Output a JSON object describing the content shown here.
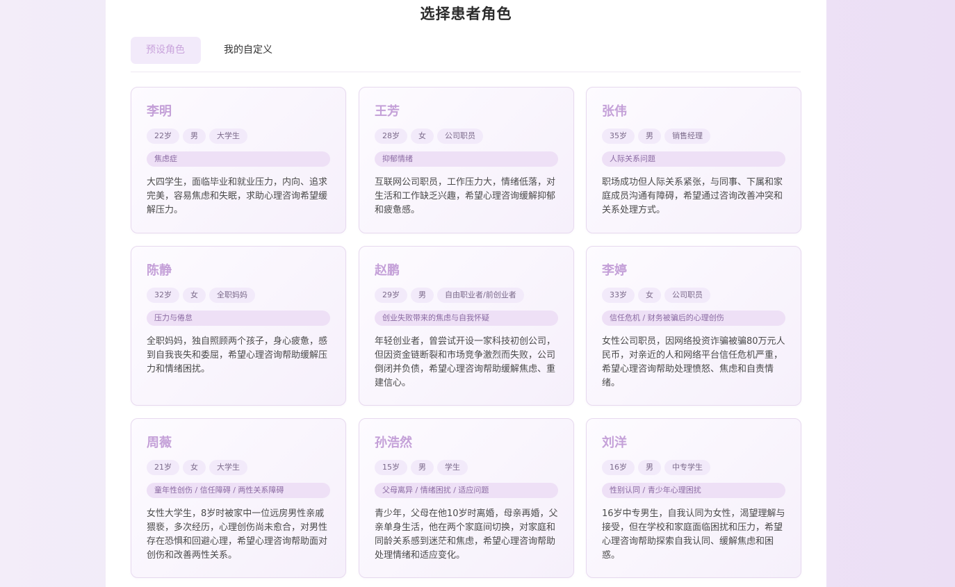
{
  "page": {
    "title": "选择患者角色"
  },
  "tabs": [
    {
      "label": "预设角色",
      "active": true
    },
    {
      "label": "我的自定义",
      "active": false
    }
  ],
  "colors": {
    "accent": "#c4a0d8",
    "tag_bg": "#f2eafa",
    "issue_bg": "#eee0f6"
  },
  "cards": [
    {
      "name": "李明",
      "tags": [
        "22岁",
        "男",
        "大学生"
      ],
      "issue": "焦虑症",
      "desc": "大四学生，面临毕业和就业压力，内向、追求完美，容易焦虑和失眠，求助心理咨询希望缓解压力。"
    },
    {
      "name": "王芳",
      "tags": [
        "28岁",
        "女",
        "公司职员"
      ],
      "issue": "抑郁情绪",
      "desc": "互联网公司职员，工作压力大，情绪低落，对生活和工作缺乏兴趣，希望心理咨询缓解抑郁和疲惫感。"
    },
    {
      "name": "张伟",
      "tags": [
        "35岁",
        "男",
        "销售经理"
      ],
      "issue": "人际关系问题",
      "desc": "职场成功但人际关系紧张，与同事、下属和家庭成员沟通有障碍，希望通过咨询改善冲突和关系处理方式。"
    },
    {
      "name": "陈静",
      "tags": [
        "32岁",
        "女",
        "全职妈妈"
      ],
      "issue": "压力与倦怠",
      "desc": "全职妈妈，独自照顾两个孩子，身心疲惫，感到自我丧失和委屈，希望心理咨询帮助缓解压力和情绪困扰。"
    },
    {
      "name": "赵鹏",
      "tags": [
        "29岁",
        "男",
        "自由职业者/前创业者"
      ],
      "issue": "创业失败带来的焦虑与自我怀疑",
      "desc": "年轻创业者，曾尝试开设一家科技初创公司，但因资金链断裂和市场竞争激烈而失败，公司倒闭并负债，希望心理咨询帮助缓解焦虑、重建信心。"
    },
    {
      "name": "李婷",
      "tags": [
        "33岁",
        "女",
        "公司职员"
      ],
      "issue": "信任危机 / 财务被骗后的心理创伤",
      "desc": "女性公司职员，因网络投资诈骗被骗80万元人民币，对亲近的人和网络平台信任危机严重，希望心理咨询帮助处理愤怒、焦虑和自责情绪。"
    },
    {
      "name": "周薇",
      "tags": [
        "21岁",
        "女",
        "大学生"
      ],
      "issue": "童年性创伤 / 信任障碍 / 两性关系障碍",
      "desc": "女性大学生，8岁时被家中一位远房男性亲戚猥亵，多次经历，心理创伤尚未愈合，对男性存在恐惧和回避心理，希望心理咨询帮助面对创伤和改善两性关系。"
    },
    {
      "name": "孙浩然",
      "tags": [
        "15岁",
        "男",
        "学生"
      ],
      "issue": "父母离异 / 情绪困扰 / 适应问题",
      "desc": "青少年，父母在他10岁时离婚，母亲再婚，父亲单身生活，他在两个家庭间切换，对家庭和同龄关系感到迷茫和焦虑，希望心理咨询帮助处理情绪和适应变化。"
    },
    {
      "name": "刘洋",
      "tags": [
        "16岁",
        "男",
        "中专学生"
      ],
      "issue": "性别认同 / 青少年心理困扰",
      "desc": "16岁中专男生，自我认同为女性，渴望理解与接受，但在学校和家庭面临困扰和压力，希望心理咨询帮助探索自我认同、缓解焦虑和困惑。"
    }
  ]
}
